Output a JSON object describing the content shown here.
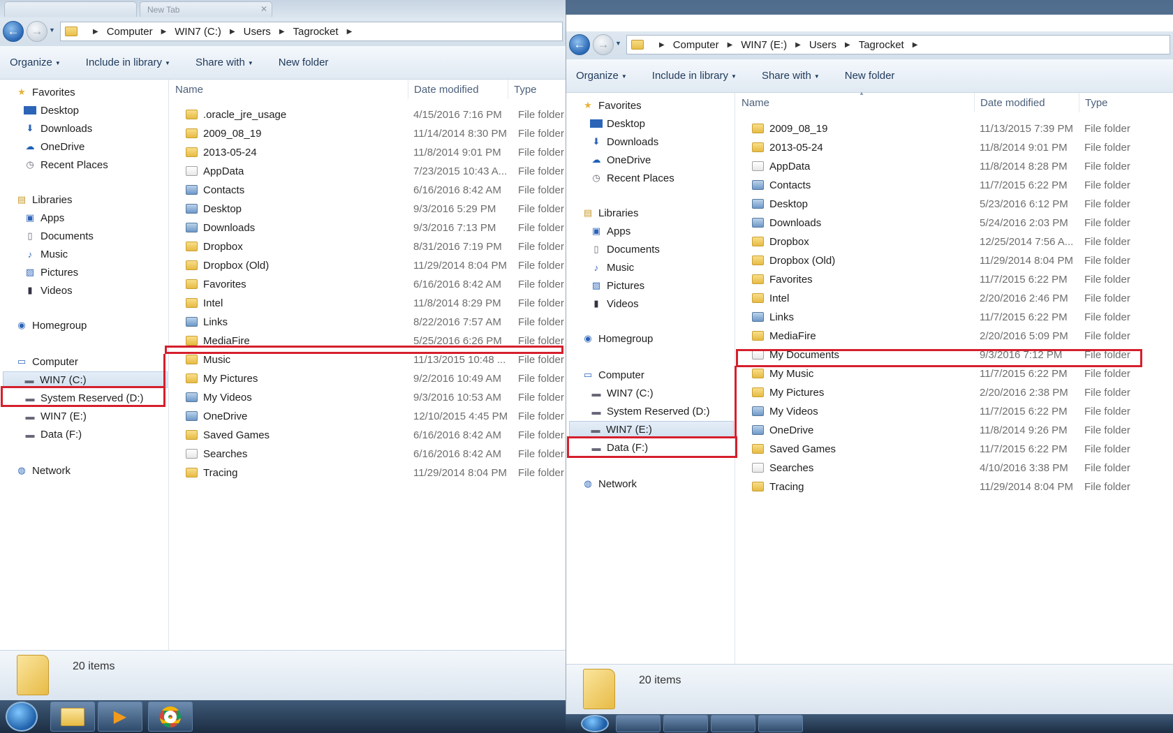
{
  "left": {
    "tab_title": "New Tab",
    "breadcrumb": [
      "Computer",
      "WIN7 (C:)",
      "Users",
      "Tagrocket"
    ],
    "toolbar": {
      "organize": "Organize",
      "include": "Include in library",
      "share": "Share with",
      "newfolder": "New folder"
    },
    "columns": {
      "name": "Name",
      "date": "Date modified",
      "type": "Type"
    },
    "nav": {
      "favorites": "Favorites",
      "desktop": "Desktop",
      "downloads": "Downloads",
      "onedrive": "OneDrive",
      "recent": "Recent Places",
      "libraries": "Libraries",
      "apps": "Apps",
      "documents": "Documents",
      "music": "Music",
      "pictures": "Pictures",
      "videos": "Videos",
      "homegroup": "Homegroup",
      "computer": "Computer",
      "c": "WIN7 (C:)",
      "d": "System Reserved (D:)",
      "e": "WIN7  (E:)",
      "f": "Data (F:)",
      "network": "Network"
    },
    "files": [
      {
        "name": ".oracle_jre_usage",
        "date": "4/15/2016 7:16 PM",
        "type": "File folder"
      },
      {
        "name": "2009_08_19",
        "date": "11/14/2014 8:30 PM",
        "type": "File folder"
      },
      {
        "name": "2013-05-24",
        "date": "11/8/2014 9:01 PM",
        "type": "File folder"
      },
      {
        "name": "AppData",
        "date": "7/23/2015 10:43 A...",
        "type": "File folder"
      },
      {
        "name": "Contacts",
        "date": "6/16/2016 8:42 AM",
        "type": "File folder"
      },
      {
        "name": "Desktop",
        "date": "9/3/2016 5:29 PM",
        "type": "File folder"
      },
      {
        "name": "Downloads",
        "date": "9/3/2016 7:13 PM",
        "type": "File folder"
      },
      {
        "name": "Dropbox",
        "date": "8/31/2016 7:19 PM",
        "type": "File folder"
      },
      {
        "name": "Dropbox (Old)",
        "date": "11/29/2014 8:04 PM",
        "type": "File folder"
      },
      {
        "name": "Favorites",
        "date": "6/16/2016 8:42 AM",
        "type": "File folder"
      },
      {
        "name": "Intel",
        "date": "11/8/2014 8:29 PM",
        "type": "File folder"
      },
      {
        "name": "Links",
        "date": "8/22/2016 7:57 AM",
        "type": "File folder"
      },
      {
        "name": "MediaFire",
        "date": "5/25/2016 6:26 PM",
        "type": "File folder"
      },
      {
        "name": "Music",
        "date": "11/13/2015 10:48 ...",
        "type": "File folder"
      },
      {
        "name": "My Pictures",
        "date": "9/2/2016 10:49 AM",
        "type": "File folder"
      },
      {
        "name": "My Videos",
        "date": "9/3/2016 10:53 AM",
        "type": "File folder"
      },
      {
        "name": "OneDrive",
        "date": "12/10/2015 4:45 PM",
        "type": "File folder"
      },
      {
        "name": "Saved Games",
        "date": "6/16/2016 8:42 AM",
        "type": "File folder"
      },
      {
        "name": "Searches",
        "date": "6/16/2016 8:42 AM",
        "type": "File folder"
      },
      {
        "name": "Tracing",
        "date": "11/29/2014 8:04 PM",
        "type": "File folder"
      }
    ],
    "status": "20 items"
  },
  "right": {
    "breadcrumb": [
      "Computer",
      "WIN7  (E:)",
      "Users",
      "Tagrocket"
    ],
    "toolbar": {
      "organize": "Organize",
      "include": "Include in library",
      "share": "Share with",
      "newfolder": "New folder"
    },
    "columns": {
      "name": "Name",
      "date": "Date modified",
      "type": "Type"
    },
    "nav": {
      "favorites": "Favorites",
      "desktop": "Desktop",
      "downloads": "Downloads",
      "onedrive": "OneDrive",
      "recent": "Recent Places",
      "libraries": "Libraries",
      "apps": "Apps",
      "documents": "Documents",
      "music": "Music",
      "pictures": "Pictures",
      "videos": "Videos",
      "homegroup": "Homegroup",
      "computer": "Computer",
      "c": "WIN7 (C:)",
      "d": "System Reserved (D:)",
      "e": "WIN7  (E:)",
      "f": "Data (F:)",
      "network": "Network"
    },
    "files": [
      {
        "name": "2009_08_19",
        "date": "11/13/2015 7:39 PM",
        "type": "File folder"
      },
      {
        "name": "2013-05-24",
        "date": "11/8/2014 9:01 PM",
        "type": "File folder"
      },
      {
        "name": "AppData",
        "date": "11/8/2014 8:28 PM",
        "type": "File folder"
      },
      {
        "name": "Contacts",
        "date": "11/7/2015 6:22 PM",
        "type": "File folder"
      },
      {
        "name": "Desktop",
        "date": "5/23/2016 6:12 PM",
        "type": "File folder"
      },
      {
        "name": "Downloads",
        "date": "5/24/2016 2:03 PM",
        "type": "File folder"
      },
      {
        "name": "Dropbox",
        "date": "12/25/2014 7:56 A...",
        "type": "File folder"
      },
      {
        "name": "Dropbox (Old)",
        "date": "11/29/2014 8:04 PM",
        "type": "File folder"
      },
      {
        "name": "Favorites",
        "date": "11/7/2015 6:22 PM",
        "type": "File folder"
      },
      {
        "name": "Intel",
        "date": "2/20/2016 2:46 PM",
        "type": "File folder"
      },
      {
        "name": "Links",
        "date": "11/7/2015 6:22 PM",
        "type": "File folder"
      },
      {
        "name": "MediaFire",
        "date": "2/20/2016 5:09 PM",
        "type": "File folder"
      },
      {
        "name": "My Documents",
        "date": "9/3/2016 7:12 PM",
        "type": "File folder"
      },
      {
        "name": "My Music",
        "date": "11/7/2015 6:22 PM",
        "type": "File folder"
      },
      {
        "name": "My Pictures",
        "date": "2/20/2016 2:38 PM",
        "type": "File folder"
      },
      {
        "name": "My Videos",
        "date": "11/7/2015 6:22 PM",
        "type": "File folder"
      },
      {
        "name": "OneDrive",
        "date": "11/8/2014 9:26 PM",
        "type": "File folder"
      },
      {
        "name": "Saved Games",
        "date": "11/7/2015 6:22 PM",
        "type": "File folder"
      },
      {
        "name": "Searches",
        "date": "4/10/2016 3:38 PM",
        "type": "File folder"
      },
      {
        "name": "Tracing",
        "date": "11/29/2014 8:04 PM",
        "type": "File folder"
      }
    ],
    "status": "20 items"
  },
  "icons": [
    "back-arrow-icon",
    "forward-arrow-icon",
    "folder-icon",
    "star-icon",
    "drive-icon",
    "network-icon",
    "homegroup-icon",
    "computer-icon",
    "library-icon",
    "chrome-icon",
    "windows-orb-icon"
  ],
  "colors": {
    "highlight": "#d61f2c",
    "accent": "#2a68b5",
    "link": "#1e395b"
  }
}
